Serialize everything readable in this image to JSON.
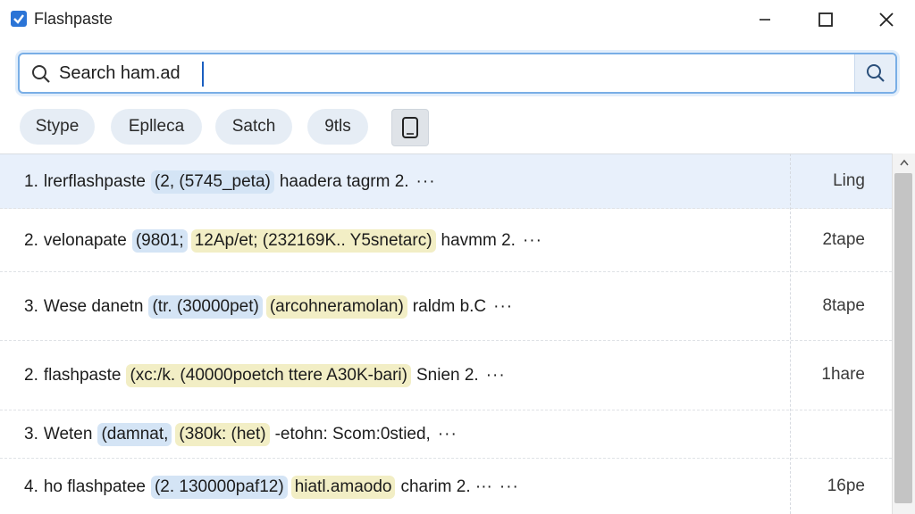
{
  "app": {
    "title": "Flashpaste"
  },
  "search": {
    "value": "Search ham.ad",
    "placeholder": ""
  },
  "chips": [
    {
      "label": "Stype"
    },
    {
      "label": "Eplleca"
    },
    {
      "label": "Satch"
    },
    {
      "label": "9tls"
    }
  ],
  "rows": [
    {
      "num": "1.",
      "title": "lrerflashpaste",
      "tags": [
        {
          "text": "(2, (5745_peta)",
          "color": "blue"
        }
      ],
      "tail": "haadera tagrm 2.",
      "meta": "Ling",
      "selected": true
    },
    {
      "num": "2.",
      "title": "velonapate",
      "tags": [
        {
          "text": "(9801;",
          "color": "blue"
        },
        {
          "text": "12Ap/et; (232169K.. Y5snetarc)",
          "color": "yellow"
        }
      ],
      "tail": "havmm 2.",
      "meta": "2tape",
      "selected": false
    },
    {
      "num": "3.",
      "title": "Wese danetn",
      "tags": [
        {
          "text": "(tr. (30000pet)",
          "color": "blue"
        },
        {
          "text": "(arcohneramolan)",
          "color": "yellow"
        }
      ],
      "tail": "raldm b.C",
      "meta": "8tape",
      "selected": false
    },
    {
      "num": "2.",
      "title": "flashpaste",
      "tags": [
        {
          "text": "(xc:/k. (40000poetch ttere A30K-bari)",
          "color": "yellow"
        }
      ],
      "tail": "Snien 2.",
      "meta": "1hare",
      "selected": false
    },
    {
      "num": "3.",
      "title": "Weten",
      "tags": [
        {
          "text": "(damnat,",
          "color": "blue"
        },
        {
          "text": "(380k: (het)",
          "color": "yellow"
        }
      ],
      "tail": "-etohn: Scom:0stied,",
      "meta": "",
      "selected": false
    },
    {
      "num": "4.",
      "title": "ho  flashpatee",
      "tags": [
        {
          "text": "(2. 130000paf12)",
          "color": "blue"
        },
        {
          "text": "hiatl.amaodo",
          "color": "yellow"
        }
      ],
      "tail": "charim 2. ···",
      "meta": "16pe",
      "selected": false
    }
  ],
  "colors": {
    "accent": "#2b74d6",
    "selected_row": "#e8f0fb",
    "tag_blue": "#d4e4f5",
    "tag_yellow": "#f2eec5"
  }
}
